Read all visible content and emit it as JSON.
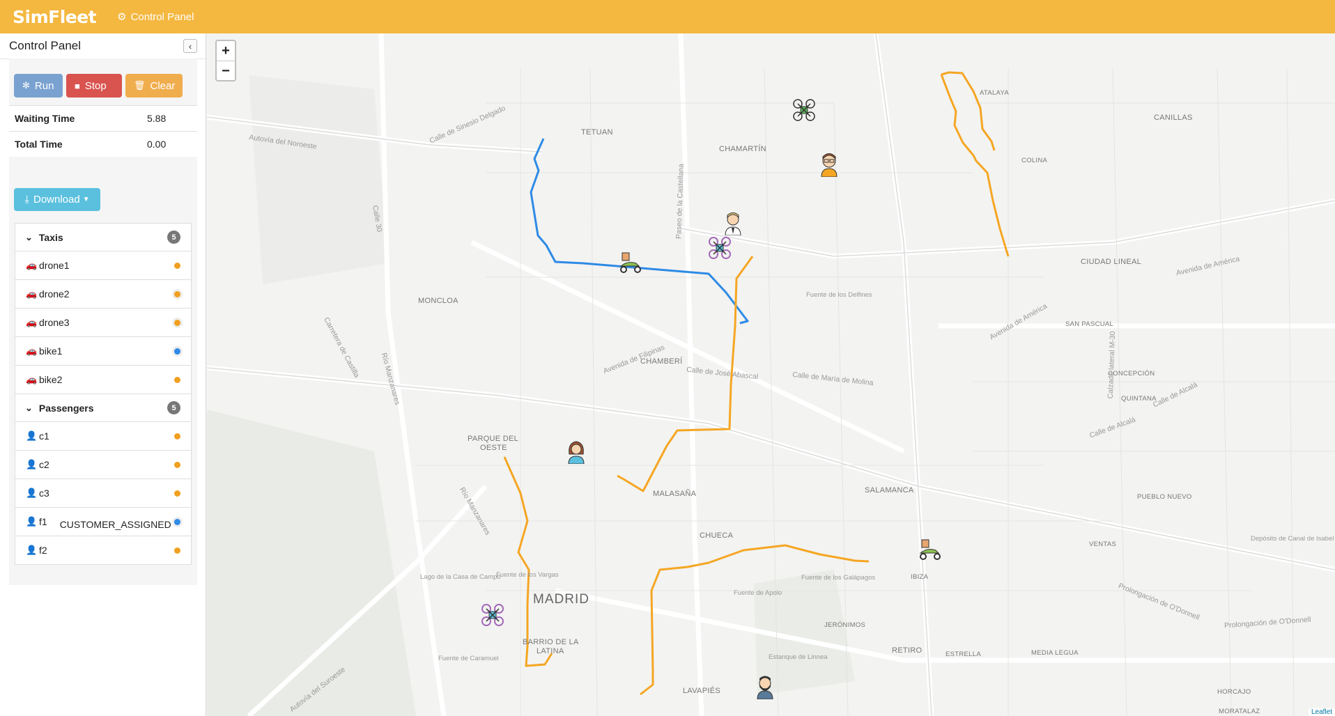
{
  "navbar": {
    "brand": "SimFleet",
    "control_panel_link": "Control Panel"
  },
  "sidebar": {
    "title": "Control Panel",
    "buttons": {
      "run": "Run",
      "stop": "Stop",
      "clear": "Clear",
      "download": "Download"
    },
    "stats": [
      {
        "label": "Waiting Time",
        "value": "5.88"
      },
      {
        "label": "Total Time",
        "value": "0.00"
      }
    ],
    "taxis": {
      "label": "Taxis",
      "count": "5",
      "items": [
        {
          "name": "drone1",
          "status_color": "#f0a020"
        },
        {
          "name": "drone2",
          "status_color": "#f0a020"
        },
        {
          "name": "drone3",
          "status_color": "#f0a020"
        },
        {
          "name": "bike1",
          "status_color": "#2e8ae6"
        },
        {
          "name": "bike2",
          "status_color": "#f0a020"
        }
      ]
    },
    "passengers": {
      "label": "Passengers",
      "count": "5",
      "items": [
        {
          "name": "c1",
          "status_color": "#f0a020",
          "status": ""
        },
        {
          "name": "c2",
          "status_color": "#f0a020",
          "status": ""
        },
        {
          "name": "c3",
          "status_color": "#f0a020",
          "status": ""
        },
        {
          "name": "f1",
          "status_color": "#2e8ae6",
          "status": "CUSTOMER_ASSIGNED"
        },
        {
          "name": "f2",
          "status_color": "#f0a020",
          "status": ""
        }
      ]
    }
  },
  "map": {
    "zoom_in": "+",
    "zoom_out": "−",
    "attribution": "Leaflet",
    "colors": {
      "route_orange": "#f5a623",
      "route_blue": "#2e8ae6"
    },
    "labels": {
      "madrid": "MADRID",
      "tetuan": "TETUAN",
      "chamartin": "CHAMARTÍN",
      "atalaya": "ATALAYA",
      "canillas": "CANILLAS",
      "colina": "COLINA",
      "ciudad_lineal": "CIUDAD LINEAL",
      "moncloa": "MONCLOA",
      "san_pascual": "SAN PASCUAL",
      "chamberi": "CHAMBERÍ",
      "concepcion": "CONCEPCIÓN",
      "quintana": "QUINTANA",
      "parque_oeste_1": "PARQUE DEL",
      "parque_oeste_2": "OESTE",
      "malasana": "MALASAÑA",
      "salamanca": "SALAMANCA",
      "pueblo_nuevo": "PUEBLO NUEVO",
      "chueca": "CHUECA",
      "ventas": "VENTAS",
      "ibiza": "IBIZA",
      "barrio_latina_1": "BARRIO DE LA",
      "barrio_latina_2": "LATINA",
      "jeronimos": "JERÓNIMOS",
      "retiro": "RETIRO",
      "estrella": "ESTRELLA",
      "media_legua": "MEDIA LEGUA",
      "lavapies": "LAVAPIÉS",
      "horcajo": "HORCAJO",
      "moratalaz": "MORATALAZ"
    },
    "streets": {
      "autovia_noroeste": "Autovía del Noroeste",
      "sinesio": "Calle de Sinesio Delgado",
      "castellana": "Paseo de la Castellana",
      "america": "Avenida de América",
      "filipinas": "Avenida de Filipinas",
      "abascal": "Calle de José Abascal",
      "maria_molina": "Calle de María de Molina",
      "delfines": "Fuente de los Delfines",
      "alcala": "Calle de Alcalá",
      "odonnell": "Prolongación de O'Donnell",
      "odonnell2": "Prolongación de O'Donnell",
      "castilla": "Carretera de Castilla",
      "lago": "Lago de la Casa de Campo",
      "vargas": "Fuente de los Vargas",
      "apolo": "Fuente de Apolo",
      "galapagos": "Fuente de los Galápagos",
      "estanque": "Estanque de Linnea",
      "caramuel": "Fuente de Caramuel",
      "suroeste": "Autovía del Suroeste",
      "deposito": "Depósito de Canal de Isabel II",
      "m30": "Calle 30",
      "manzanares": "Río Manzanares",
      "paseo": "Paseo",
      "m30b": "M-30",
      "paz": "Calzada lateral M-30"
    }
  }
}
